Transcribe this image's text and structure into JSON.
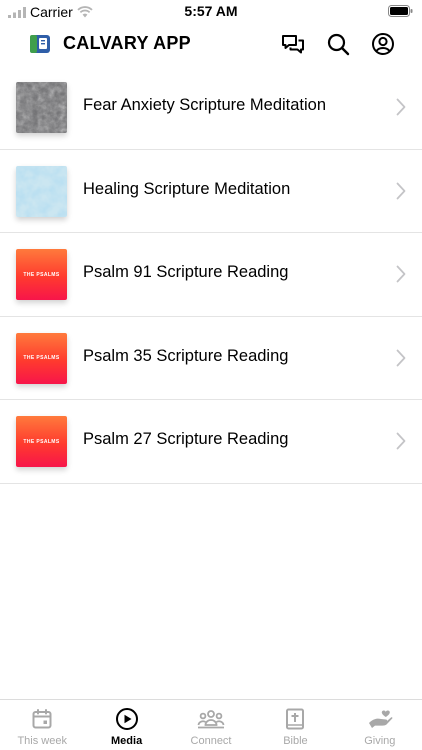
{
  "status_bar": {
    "carrier": "Carrier",
    "time": "5:57 AM"
  },
  "header": {
    "title": "CALVARY APP",
    "icons": [
      "chat-icon",
      "search-icon",
      "account-icon"
    ]
  },
  "media_items": [
    {
      "title": "Fear Anxiety Scripture Meditation",
      "thumb": "gray-stone-texture"
    },
    {
      "title": "Healing Scripture Meditation",
      "thumb": "blue-water-texture"
    },
    {
      "title": "Psalm 91 Scripture Reading",
      "thumb": "the-psalms",
      "thumb_text": "THE PSALMS"
    },
    {
      "title": "Psalm 35 Scripture Reading",
      "thumb": "the-psalms",
      "thumb_text": "THE PSALMS"
    },
    {
      "title": "Psalm 27 Scripture Reading",
      "thumb": "the-psalms",
      "thumb_text": "THE PSALMS"
    }
  ],
  "tabs": [
    {
      "label": "This week",
      "icon": "calendar-icon",
      "active": false
    },
    {
      "label": "Media",
      "icon": "play-icon",
      "active": true
    },
    {
      "label": "Connect",
      "icon": "group-icon",
      "active": false
    },
    {
      "label": "Bible",
      "icon": "bible-icon",
      "active": false
    },
    {
      "label": "Giving",
      "icon": "giving-hand-icon",
      "active": false
    }
  ],
  "colors": {
    "active_tab": "#000000",
    "inactive_tab": "#a8a8a8",
    "psalms_gradient_top": "#ff7a3c",
    "psalms_gradient_bottom": "#f7154a"
  }
}
